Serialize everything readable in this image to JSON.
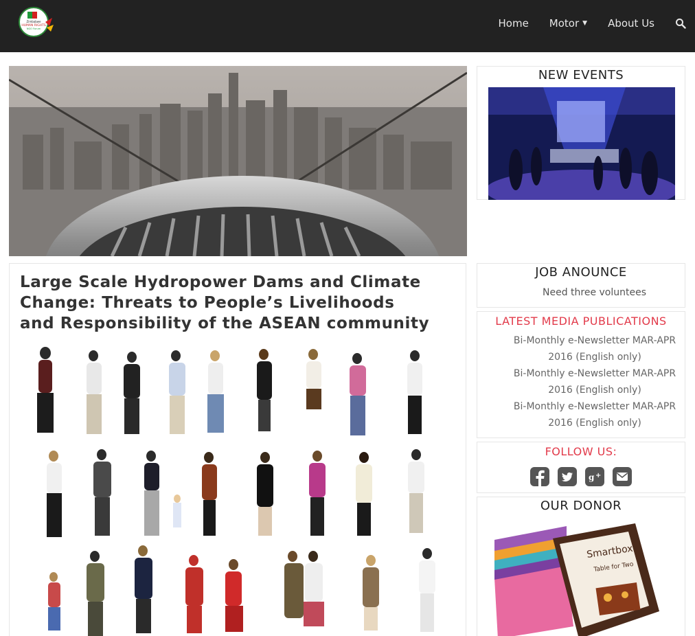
{
  "nav": {
    "logo_alt": "Zimbabwe Human Rights NGO Forum",
    "items": [
      {
        "label": "Home"
      },
      {
        "label": "Motor",
        "has_dropdown": true
      },
      {
        "label": "About Us"
      }
    ],
    "search_icon": "search-icon"
  },
  "sidebar": {
    "events_title": "NEW EVENTS",
    "job_title": "JOB ANOUNCE",
    "job_text": "Need three voluntees",
    "media_title": "LATEST MEDIA PUBLICATIONS",
    "media_items": [
      "Bi-Monthly e-Newsletter MAR-APR 2016 (English only)",
      "Bi-Monthly e-Newsletter MAR-APR 2016 (English only)",
      "Bi-Monthly e-Newsletter MAR-APR 2016 (English only)"
    ],
    "follow_title": "FOLLOW US:",
    "social_icons": [
      "facebook-icon",
      "twitter-icon",
      "google-plus-icon",
      "email-icon"
    ],
    "donor_title": "OUR DONOR"
  },
  "article": {
    "title": "Large Scale Hydropower Dams and Climate Change: Threats to People’s Livelihoods and Responsibility of the ASEAN community"
  },
  "colors": {
    "navbar": "#222222",
    "accent_red": "#e23a4a",
    "social_gray": "#555555"
  }
}
